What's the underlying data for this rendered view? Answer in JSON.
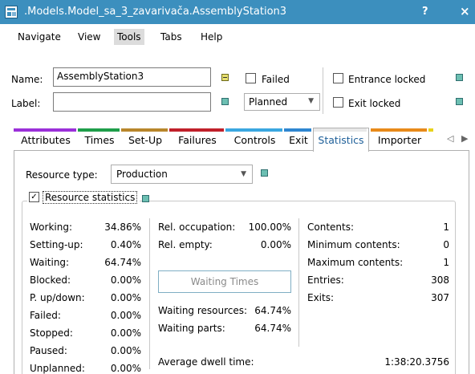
{
  "window": {
    "title": ".Models.Model_sa_3_zavarivača.AssemblyStation3",
    "help": "?",
    "close": "×"
  },
  "menu": [
    "Navigate",
    "View",
    "Tools",
    "Tabs",
    "Help"
  ],
  "form": {
    "name_label": "Name:",
    "name_value": "AssemblyStation3",
    "label_label": "Label:",
    "label_value": "",
    "failed": "Failed",
    "planned": "Planned",
    "entrance_locked": "Entrance locked",
    "exit_locked": "Exit locked"
  },
  "tabs": [
    {
      "label": "Attributes",
      "color": "#9b30d9"
    },
    {
      "label": "Times",
      "color": "#1f9e4a"
    },
    {
      "label": "Set-Up",
      "color": "#b8862b"
    },
    {
      "label": "Failures",
      "color": "#c0202a"
    },
    {
      "label": "Controls",
      "color": "#3aa7e0"
    },
    {
      "label": "Exit",
      "color": "#2f86d0"
    },
    {
      "label": "Statistics",
      "color": "#e8e8e8"
    },
    {
      "label": "Importer",
      "color": "#e88a1a"
    }
  ],
  "stats": {
    "resource_type_label": "Resource type:",
    "resource_type_value": "Production",
    "group_title": "Resource statistics",
    "left": [
      {
        "label": "Working:",
        "value": "34.86%"
      },
      {
        "label": "Setting-up:",
        "value": "0.40%"
      },
      {
        "label": "Waiting:",
        "value": "64.74%"
      },
      {
        "label": "Blocked:",
        "value": "0.00%"
      },
      {
        "label": "P. up/down:",
        "value": "0.00%"
      },
      {
        "label": "Failed:",
        "value": "0.00%"
      },
      {
        "label": "Stopped:",
        "value": "0.00%"
      },
      {
        "label": "Paused:",
        "value": "0.00%"
      },
      {
        "label": "Unplanned:",
        "value": "0.00%"
      }
    ],
    "middle": [
      {
        "label": "Rel. occupation:",
        "value": "100.00%"
      },
      {
        "label": "Rel. empty:",
        "value": "0.00%"
      }
    ],
    "waiting_times_button": "Waiting Times",
    "waiting": [
      {
        "label": "Waiting resources:",
        "value": "64.74%"
      },
      {
        "label": "Waiting parts:",
        "value": "64.74%"
      }
    ],
    "right": [
      {
        "label": "Contents:",
        "value": "1"
      },
      {
        "label": "Minimum contents:",
        "value": "0"
      },
      {
        "label": "Maximum contents:",
        "value": "1"
      },
      {
        "label": "Entries:",
        "value": "308"
      },
      {
        "label": "Exits:",
        "value": "307"
      }
    ],
    "avg_dwell_label": "Average dwell time:",
    "avg_dwell_value": "1:38:20.3756"
  }
}
